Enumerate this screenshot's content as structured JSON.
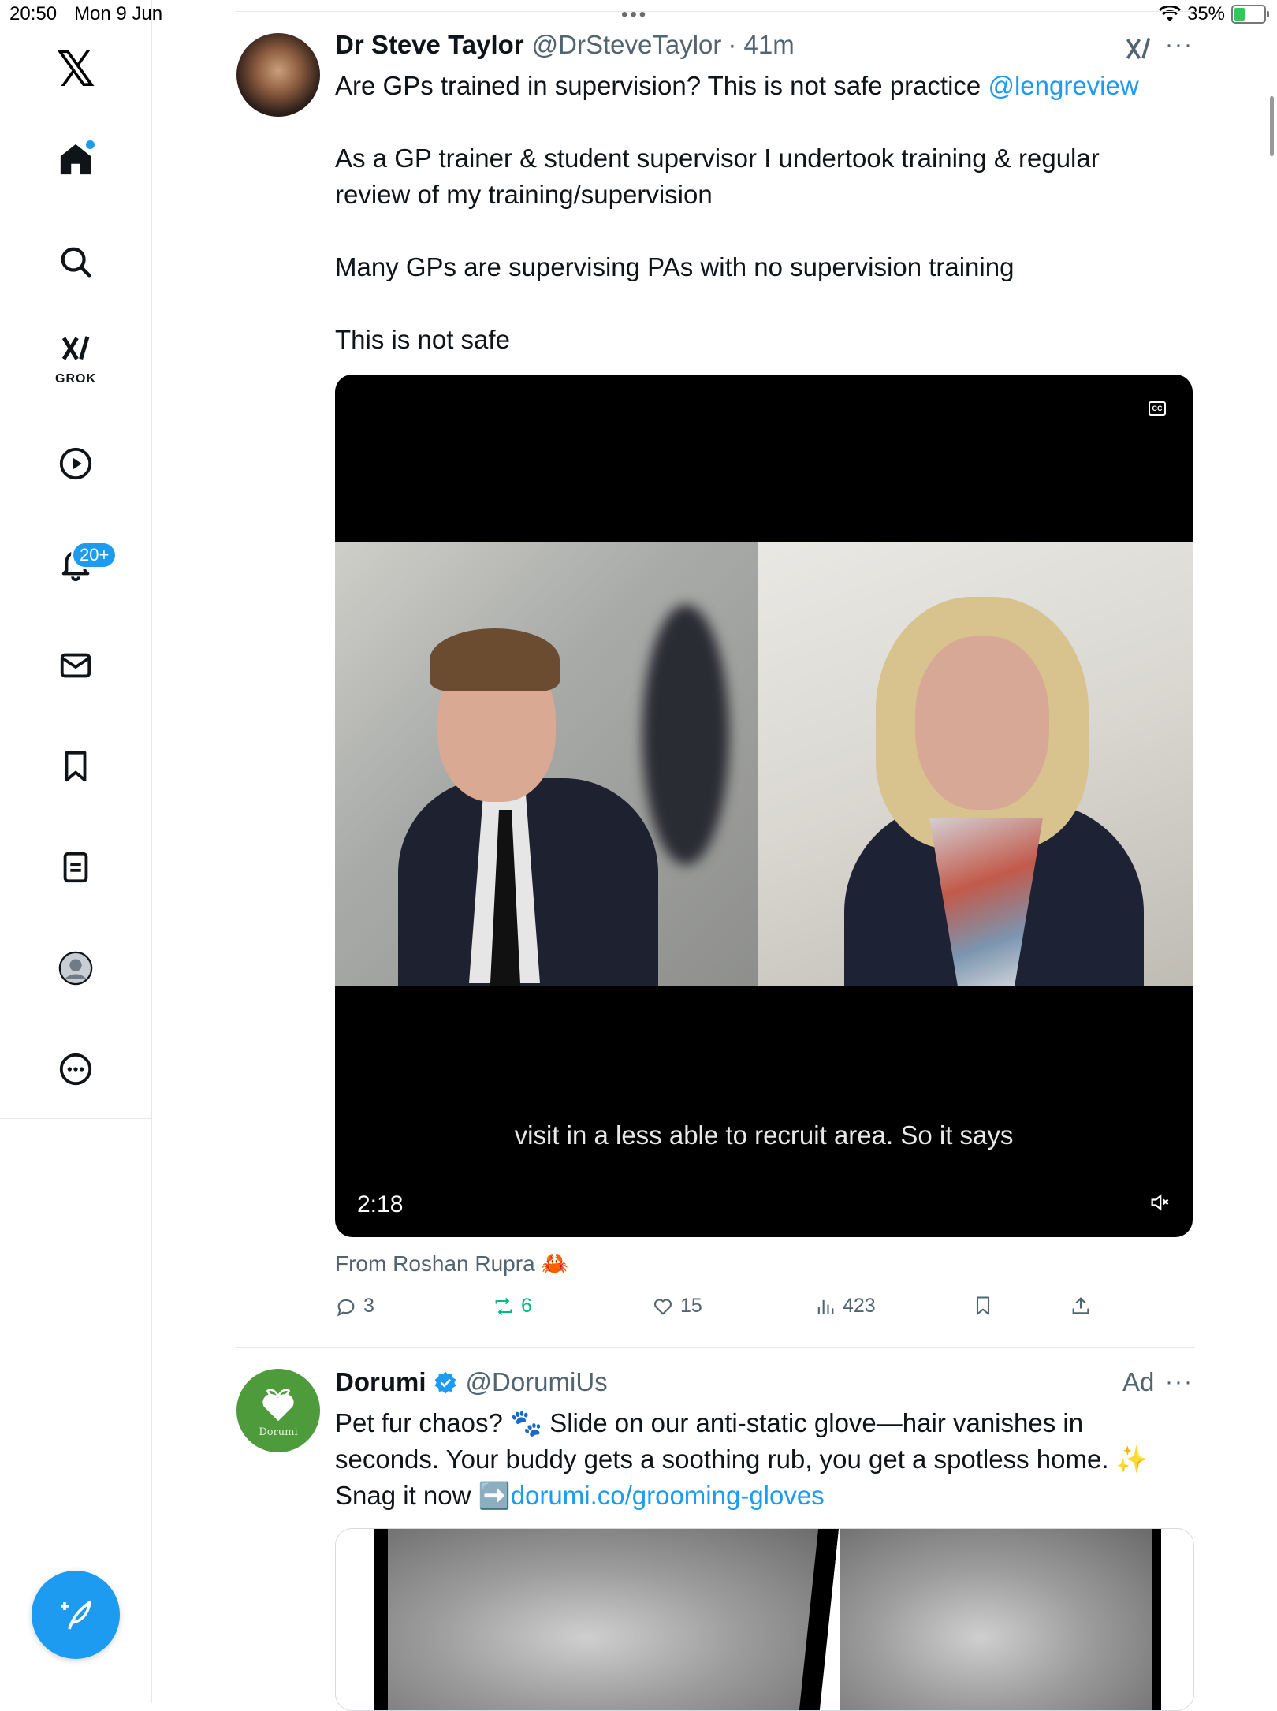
{
  "status_bar": {
    "time": "20:50",
    "date": "Mon 9 Jun",
    "battery": "35%",
    "battery_level": 0.35
  },
  "sidebar": {
    "grok_label": "GROK",
    "notifications_badge": "20+"
  },
  "tweet": {
    "name": "Dr Steve Taylor",
    "handle": "@DrSteveTaylor",
    "time": "· 41m",
    "line1": "Are GPs trained in supervision? This is not safe practice ",
    "mention": "@lengreview",
    "para2": "As a GP trainer & student supervisor I undertook training  & regular review of my training/supervision",
    "para3": "Many GPs are supervising PAs with no supervision training",
    "para4": "This is not safe",
    "video": {
      "subtitle": "visit in a less able to recruit area. So it says",
      "duration": "2:18"
    },
    "from": "From Roshan Rupra 🦀",
    "replies": "3",
    "reposts": "6",
    "likes": "15",
    "views": "423"
  },
  "ad": {
    "name": "Dorumi",
    "handle": "@DorumiUs",
    "ad_label": "Ad",
    "avatar_text": "Dorumi",
    "text": "Pet fur chaos? 🐾 Slide on our anti-static glove—hair vanishes in seconds. Your buddy gets a soothing rub, you get a spotless home. ✨ Snag it now ➡️",
    "link": "dorumi.co/grooming-gloves"
  },
  "colors": {
    "accent": "#1d9bf0",
    "repost_green": "#00ba7c",
    "muted": "#536471"
  }
}
